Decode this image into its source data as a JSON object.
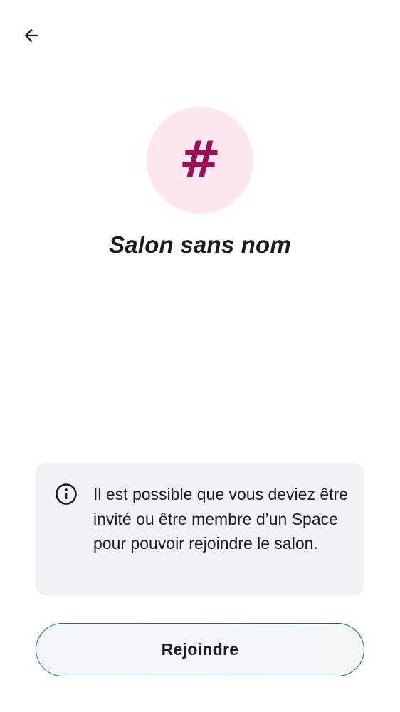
{
  "header": {
    "back_icon": "arrow-left-icon"
  },
  "room": {
    "avatar_glyph": "#",
    "avatar_color": "#9b0f55",
    "avatar_background": "#fde7ee",
    "name": "Salon sans nom"
  },
  "notice": {
    "icon": "info-icon",
    "text": "Il est possible que vous deviez être invité ou être membre d’un Space pour pouvoir rejoindre le salon."
  },
  "actions": {
    "join_label": "Rejoindre"
  }
}
